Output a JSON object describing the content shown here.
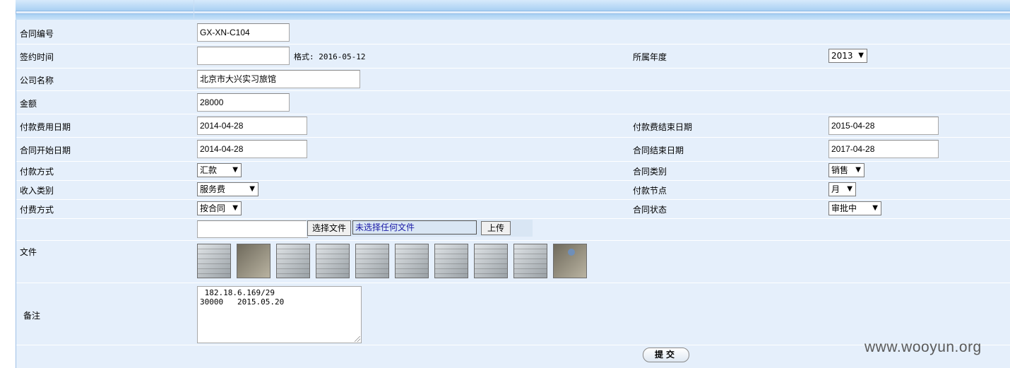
{
  "form": {
    "contract_no": {
      "label": "合同编号",
      "value": "GX-XN-C104"
    },
    "sign_time": {
      "label": "签约时间",
      "value": "",
      "hint": "格式: 2016-05-12"
    },
    "fiscal_year": {
      "label": "所属年度",
      "value": "2013"
    },
    "company_name": {
      "label": "公司名称",
      "value": "北京市大兴实习旅馆"
    },
    "amount": {
      "label": "金额",
      "value": "28000"
    },
    "fee_start": {
      "label": "付款费用日期",
      "value": "2014-04-28"
    },
    "fee_end": {
      "label": "付款费结束日期",
      "value": "2015-04-28"
    },
    "contract_start": {
      "label": "合同开始日期",
      "value": "2014-04-28"
    },
    "contract_end": {
      "label": "合同结束日期",
      "value": "2017-04-28"
    },
    "payment_method": {
      "label": "付款方式",
      "value": "汇款"
    },
    "contract_type": {
      "label": "合同类别",
      "value": "销售"
    },
    "income_type": {
      "label": "收入类别",
      "value": "服务费"
    },
    "payment_node": {
      "label": "付款节点",
      "value": "月"
    },
    "fee_method": {
      "label": "付费方式",
      "value": "按合同"
    },
    "contract_status": {
      "label": "合同状态",
      "value": "审批中"
    },
    "file": {
      "label": "文件",
      "choose_button": "选择文件",
      "no_file_text": "未选择任何文件",
      "upload_button": "上传",
      "thumbnail_count": 10
    },
    "remarks": {
      "label": "备注",
      "value": " 182.18.6.169/29\n30000   2015.05.20"
    },
    "submit_label": "提交"
  },
  "watermark": "www.wooyun.org",
  "colors": {
    "form_bg": "#e5effb",
    "header": "#a9d0f3"
  }
}
